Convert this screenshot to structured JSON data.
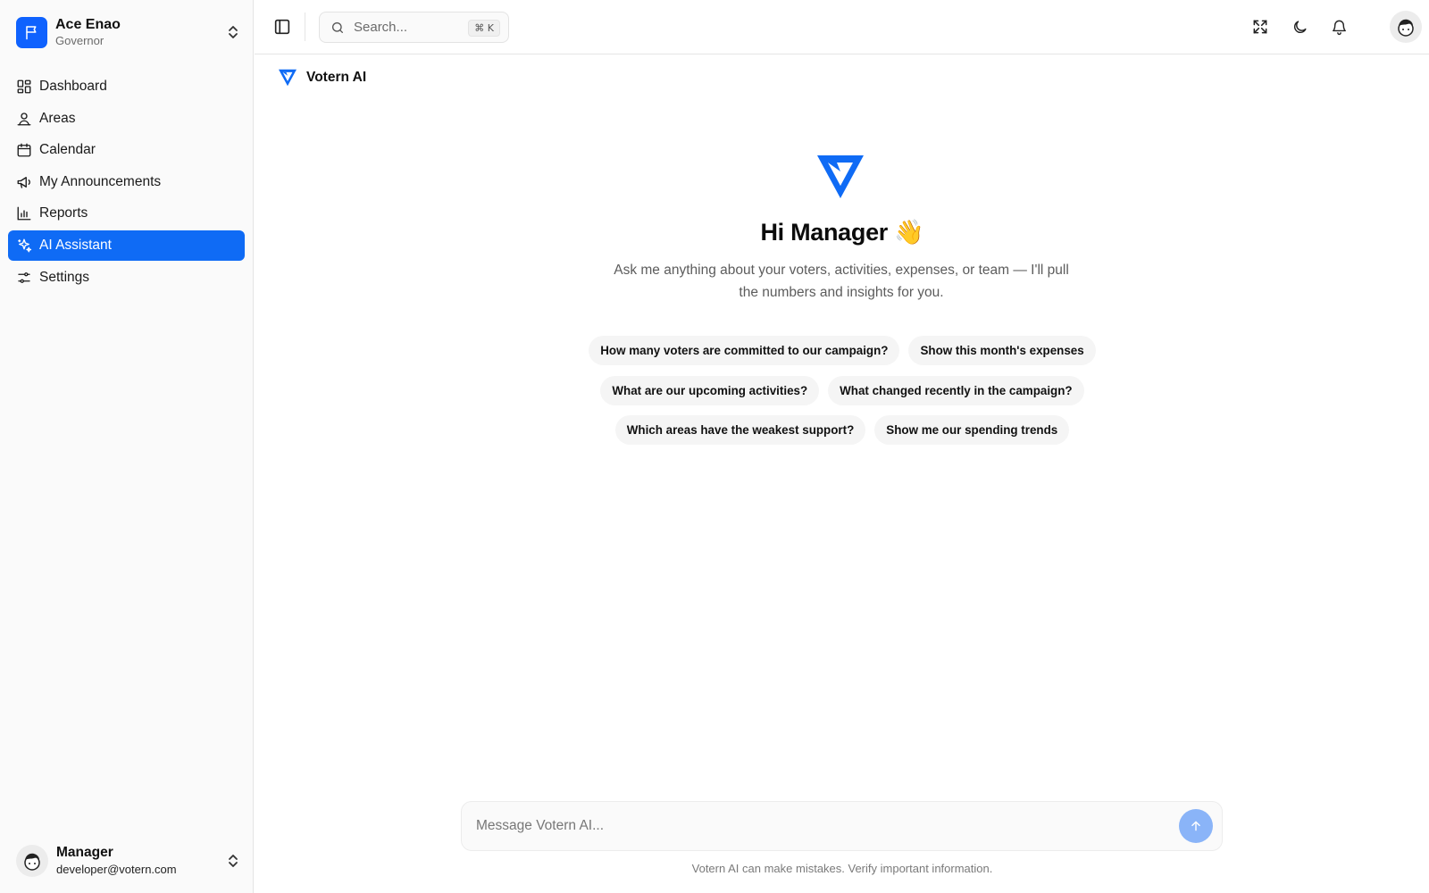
{
  "org": {
    "name": "Ace Enao",
    "role": "Governor"
  },
  "nav": [
    {
      "label": "Dashboard",
      "icon": "dashboard-icon",
      "active": false
    },
    {
      "label": "Areas",
      "icon": "map-pin-icon",
      "active": false
    },
    {
      "label": "Calendar",
      "icon": "calendar-icon",
      "active": false
    },
    {
      "label": "My Announcements",
      "icon": "megaphone-icon",
      "active": false
    },
    {
      "label": "Reports",
      "icon": "bar-chart-icon",
      "active": false
    },
    {
      "label": "AI Assistant",
      "icon": "sparkles-icon",
      "active": true
    },
    {
      "label": "Settings",
      "icon": "sliders-icon",
      "active": false
    }
  ],
  "user": {
    "name": "Manager",
    "email": "developer@votern.com"
  },
  "topbar": {
    "search_placeholder": "Search...",
    "search_shortcut": "⌘ K"
  },
  "page": {
    "title": "Votern AI"
  },
  "hero": {
    "greeting": "Hi Manager 👋",
    "intro": "Ask me anything about your voters, activities, expenses, or team — I'll pull the numbers and insights for you."
  },
  "suggestions": [
    [
      "How many voters are committed to our campaign?",
      "Show this month's expenses"
    ],
    [
      "What are our upcoming activities?",
      "What changed recently in the campaign?"
    ],
    [
      "Which areas have the weakest support?",
      "Show me our spending trends"
    ]
  ],
  "composer": {
    "placeholder": "Message Votern AI...",
    "disclaimer": "Votern AI can make mistakes. Verify important information."
  },
  "colors": {
    "accent": "#0f6bf5",
    "send_button": "#8ab4f8",
    "sidebar_bg": "#fafafa"
  }
}
